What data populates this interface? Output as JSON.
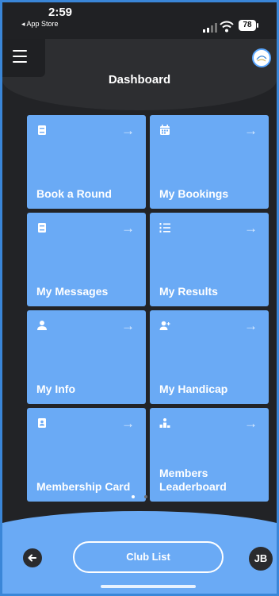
{
  "status_bar": {
    "time": "2:59",
    "back_app": "◂ App Store",
    "battery": "78"
  },
  "header": {
    "title": "Dashboard"
  },
  "tiles": [
    {
      "label": "Book a Round",
      "icon": "book-icon"
    },
    {
      "label": "My Bookings",
      "icon": "calendar-icon"
    },
    {
      "label": "My Messages",
      "icon": "book-icon"
    },
    {
      "label": "My Results",
      "icon": "list-numbered-icon"
    },
    {
      "label": "My Info",
      "icon": "person-icon"
    },
    {
      "label": "My Handicap",
      "icon": "person-add-icon"
    },
    {
      "label": "Membership Card",
      "icon": "id-card-icon"
    },
    {
      "label": "Members Leaderboard",
      "icon": "leaderboard-icon"
    }
  ],
  "tile_arrow": "→",
  "pager": {
    "pages": 2,
    "active": 1
  },
  "bottom_bar": {
    "club_list_label": "Club List",
    "user_initials": "JB"
  },
  "colors": {
    "tile": "#6aaaf5",
    "background": "#222326",
    "frame_border": "#3a86d8"
  }
}
